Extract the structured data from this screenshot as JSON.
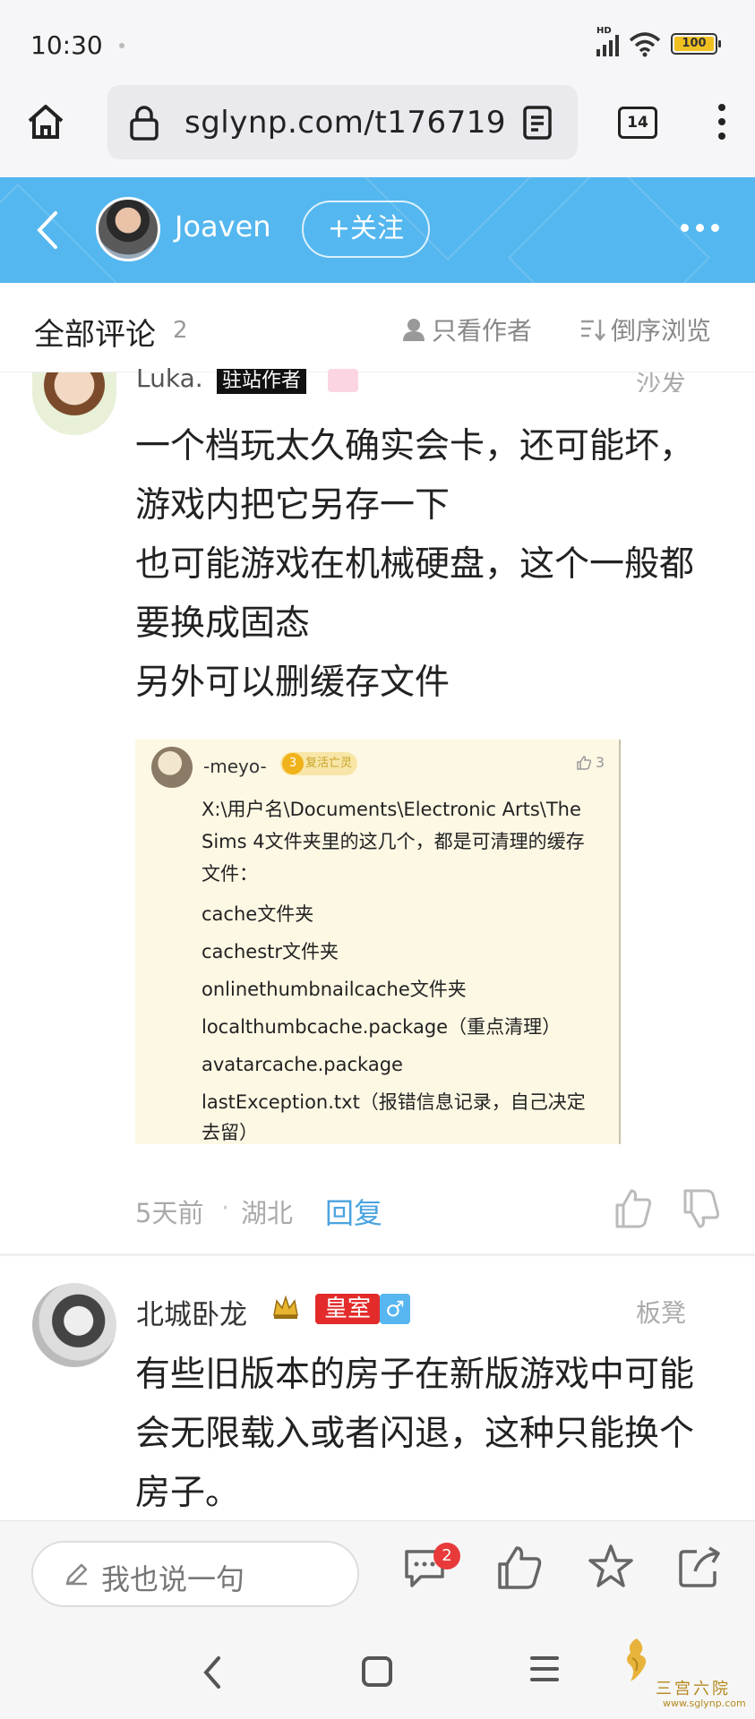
{
  "status_bar": {
    "time": "10:30",
    "signal_label": "HD",
    "wifi_label": "6",
    "battery": "100"
  },
  "browser": {
    "url": "sglynp.com/t176719",
    "tab_count": "14"
  },
  "header": {
    "author_name": "Joaven",
    "follow_label": "+关注"
  },
  "comments_bar": {
    "title": "全部评论",
    "count": "2",
    "author_only": "只看作者",
    "reverse_order": "倒序浏览"
  },
  "floor1": {
    "user": "Luka.",
    "owner_badge": "驻站作者",
    "floor_label": "沙发",
    "paragraphs": [
      "一个档玩太久确实会卡，还可能坏，游戏内把它另存一下",
      "也可能游戏在机械硬盘，这个一般都要换成固态",
      "另外可以删缓存文件"
    ],
    "embed": {
      "user": "-meyo-",
      "level": "3",
      "badge": "复活亡灵",
      "likes": "3",
      "lines": [
        "X:\\用户名\\Documents\\Electronic Arts\\The Sims 4文件夹里的这几个，都是可清理的缓存文件：",
        "cache文件夹",
        "cachestr文件夹",
        "onlinethumbnailcache文件夹",
        "localthumbcache.package（重点清理）",
        "avatarcache.package",
        "lastException.txt（报错信息记录，自己决定去留）"
      ]
    },
    "time": "5天前",
    "separator": "·",
    "location": "湖北",
    "reply_label": "回复"
  },
  "floor2": {
    "user": "北城卧龙",
    "royal_badge": "皇室",
    "gender_badge": "♂",
    "floor_label": "板凳",
    "text": "有些旧版本的房子在新版游戏中可能会无限载入或者闪退，这种只能换个房子。"
  },
  "bottom_bar": {
    "placeholder": "我也说一句",
    "comment_badge": "2"
  },
  "watermark": {
    "title": "三宫六院",
    "url": "www.sglynp.com"
  },
  "colors": {
    "header_blue": "#54b7ef",
    "link_blue": "#4aa3df",
    "royal_red": "#e32b2b",
    "badge_red": "#e83a3a"
  },
  "icons": [
    "home-icon",
    "lock-icon",
    "reader-mode-icon",
    "more-vertical-icon",
    "back-icon",
    "more-horizontal-icon",
    "user-icon",
    "sort-icon",
    "thumb-up-icon",
    "thumb-down-icon",
    "pencil-icon",
    "comment-icon",
    "star-icon",
    "share-icon",
    "crown-icon"
  ]
}
